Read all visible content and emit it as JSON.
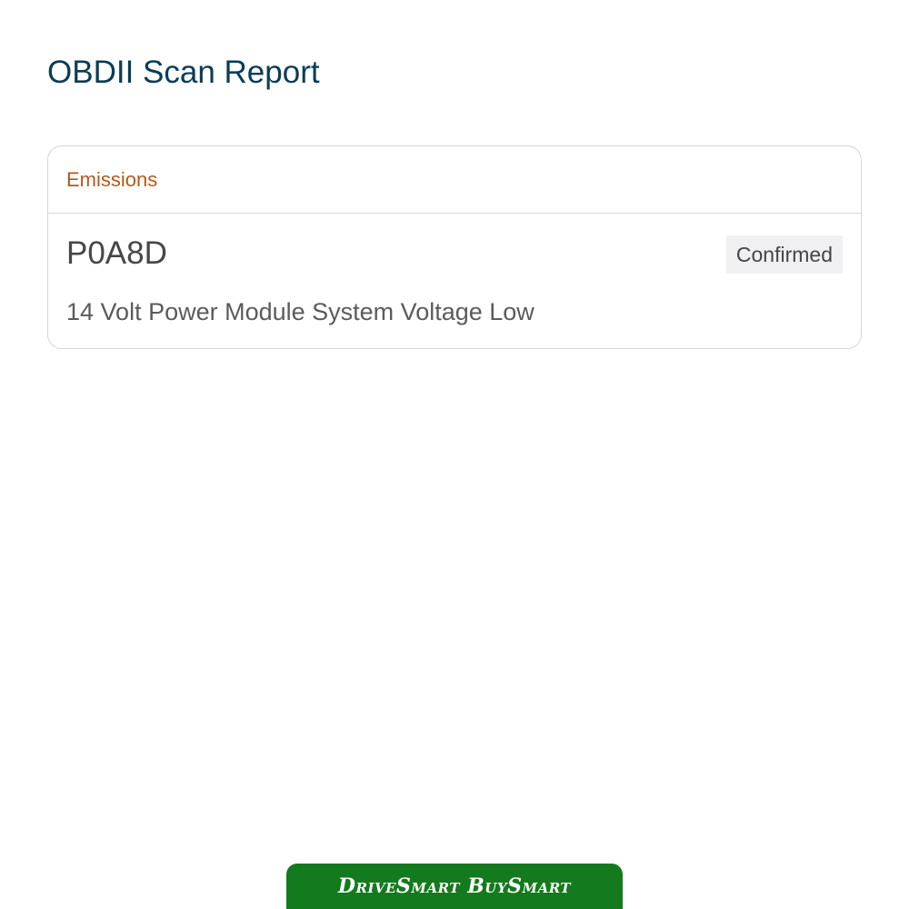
{
  "header": {
    "title": "OBDII Scan Report"
  },
  "report": {
    "sections": [
      {
        "category": "Emissions",
        "code": "P0A8D",
        "status": "Confirmed",
        "description": "14 Volt Power Module System Voltage Low"
      }
    ]
  },
  "footer": {
    "brand": "DriveSmart BuySmart",
    "brand_color": "#137a1d"
  },
  "colors": {
    "title": "#0a3d56",
    "category": "#b5581a",
    "badge_bg": "#f0f0f2"
  }
}
